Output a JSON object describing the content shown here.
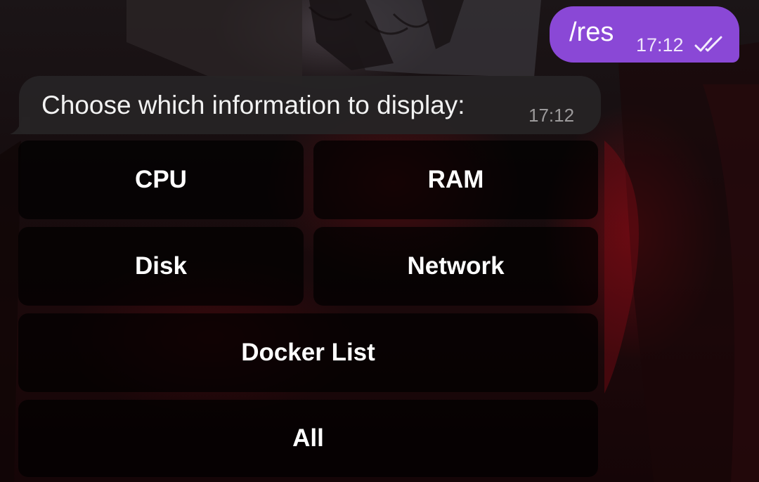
{
  "outgoing_message": {
    "text": "/res",
    "time": "17:12",
    "status_icon": "double-check-icon",
    "bubble_color": "#8a48d6"
  },
  "incoming_message": {
    "text": "Choose which information to display:",
    "time": "17:12",
    "bubble_color": "#262425"
  },
  "inline_keyboard": {
    "rows": [
      [
        "CPU",
        "RAM"
      ],
      [
        "Disk",
        "Network"
      ],
      [
        "Docker List"
      ],
      [
        "All"
      ]
    ]
  }
}
